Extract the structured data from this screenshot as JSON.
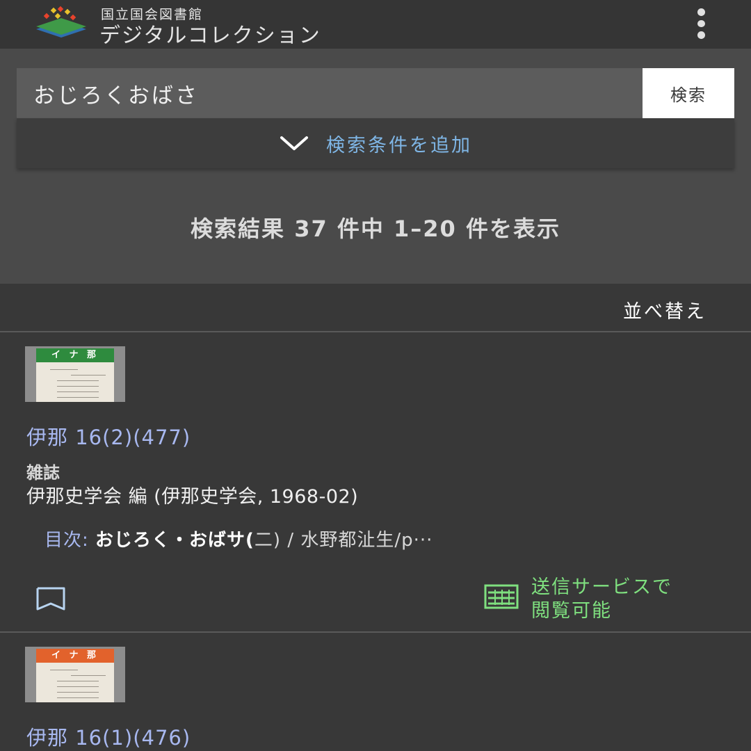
{
  "header": {
    "org_name": "国立国会図書館",
    "service_name": "デジタルコレクション",
    "logo_icon": "ndl-logo-icon",
    "menu_icon": "more-vertical-icon"
  },
  "search": {
    "query": "おじろくおばさ",
    "button_label": "検索",
    "add_conditions_label": "検索条件を追加",
    "add_conditions_icon": "chevron-down-icon"
  },
  "results_summary": "検索結果 37 件中 1–20 件を表示",
  "sort_label": "並べ替え",
  "results": [
    {
      "title": "伊那 16(2)(477)",
      "cover_title": "イ ナ 那",
      "cover_color": "#2e8b3e",
      "type": "雑誌",
      "publisher": "伊那史学会 編 (伊那史学会, 1968-02)",
      "toc_label": "目次:",
      "toc_bold": "おじろく・おばサ(",
      "toc_rest": "二) / 水野都沚生/p···",
      "bookmark_icon": "bookmark-icon",
      "access_icon": "remote-service-icon",
      "access_label_line1": "送信サービスで",
      "access_label_line2": "閲覧可能",
      "access_color": "#7fe07f"
    },
    {
      "title": "伊那 16(1)(476)",
      "cover_title": "イ ナ 那",
      "cover_color": "#e2622c"
    }
  ],
  "colors": {
    "link": "#a8b8f0",
    "accent_blue": "#7fb6e6",
    "background": "#3a3a3a"
  }
}
